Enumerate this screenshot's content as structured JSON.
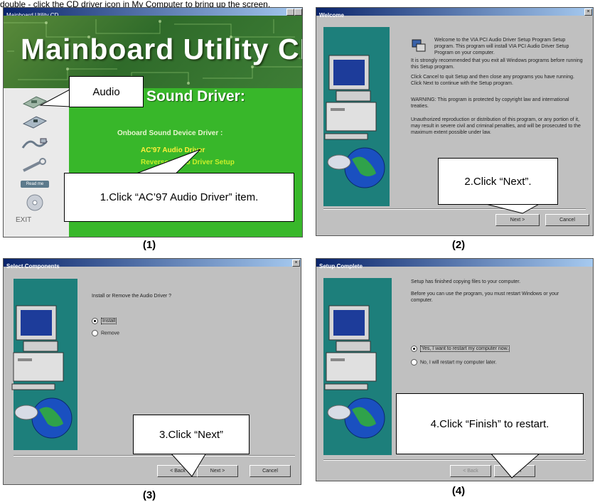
{
  "intro_text": "double - click the CD driver icon in My Computer to bring up the screen.",
  "panel1": {
    "window_title": "Mainboard Utility CD",
    "main_title": "Mainboard Utility CD",
    "section_title": "Sound Driver:",
    "subheading": "Onboard Sound Device Driver :",
    "item_ac97": "AC'97 Audio Driver",
    "item_reverse": "Reverse Audio Driver Setup",
    "exit_label": "EXIT",
    "callout_audio": "Audio",
    "callout_step1": "1.Click “AC’97 Audio Driver” item.",
    "caption": "(1)"
  },
  "panel2": {
    "window_title": "Welcome",
    "para1": "Welcome to the VIA PCI Audio Driver Setup Program Setup program. This program will install VIA PCI Audio Driver Setup Program on your computer.",
    "para2": "It is strongly recommended that you exit all Windows programs before running this Setup program.",
    "para3": "Click Cancel to quit Setup and then close any programs you have running. Click Next to continue with the Setup program.",
    "para4": "WARNING: This program is protected by copyright law and international treaties.",
    "para5": "Unauthorized reproduction or distribution of this program, or any portion of it, may result in severe civil and criminal penalties, and will be prosecuted to the maximum extent possible under law.",
    "next_button": "Next >",
    "cancel_button": "Cancel",
    "callout_step2": "2.Click “Next”.",
    "caption": "(2)"
  },
  "panel3": {
    "window_title": "Select Components",
    "question": "Install or Remove the Audio Driver ?",
    "option_install": "Install",
    "option_remove": "Remove",
    "back_button": "< Back",
    "next_button": "Next >",
    "cancel_button": "Cancel",
    "callout_step3": "3.Click “Next”",
    "caption": "(3)"
  },
  "panel4": {
    "window_title": "Setup Complete",
    "line1": "Setup has finished copying files to your computer.",
    "line2": "Before you can use the program, you must restart Windows or your computer.",
    "option_restart_now": "Yes, I want to restart my computer now.",
    "option_restart_later": "No, I will restart my computer later.",
    "back_button": "< Back",
    "finish_button": "Finish",
    "callout_step4": "4.Click “Finish” to restart.",
    "caption": "(4)"
  },
  "colors": {
    "green_panel": "#38b72a",
    "teal_sidebar": "#1d7f7b",
    "dialog_gray": "#c0c0c0",
    "titlebar_blue": "#0a246a"
  }
}
